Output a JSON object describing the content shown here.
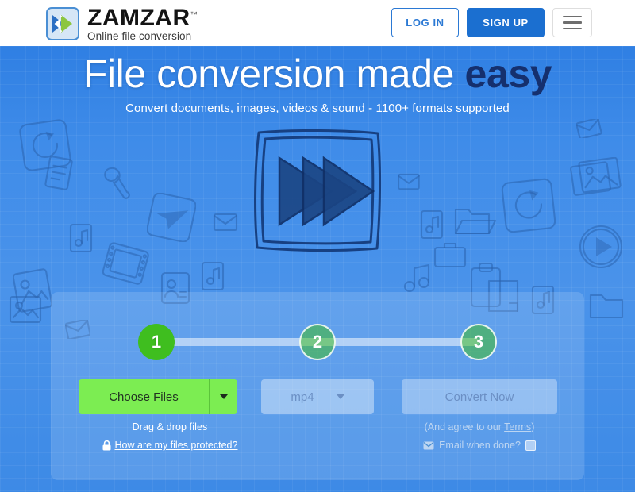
{
  "header": {
    "logo": {
      "icon": "double-chevron-logo-icon",
      "title": "ZAMZAR",
      "tm": "™",
      "tagline": "Online file conversion"
    },
    "login_label": "LOG IN",
    "signup_label": "SIGN UP",
    "menu_icon": "hamburger-menu-icon"
  },
  "hero": {
    "headline_main": "File conversion made ",
    "headline_accent": "easy",
    "subheadline": "Convert documents, images, videos & sound - 1100+ formats supported",
    "illustration_icon": "fast-forward-sketch-icon"
  },
  "converter": {
    "steps": [
      {
        "number": "1",
        "state": "active"
      },
      {
        "number": "2",
        "state": "inactive"
      },
      {
        "number": "3",
        "state": "inactive"
      }
    ],
    "choose_files_label": "Choose Files",
    "choose_files_caret_icon": "chevron-down-icon",
    "format_value": "mp4",
    "format_caret_icon": "chevron-down-icon",
    "convert_label": "Convert Now",
    "drag_drop_text": "Drag & drop files",
    "protected_link": "How are my files protected?",
    "lock_icon": "lock-icon",
    "terms_prefix": "(And agree to our ",
    "terms_link": "Terms",
    "terms_suffix": ")",
    "email_icon": "envelope-icon",
    "email_label": "Email when done?",
    "email_checked": false
  },
  "colors": {
    "brand_blue": "#1b6fd0",
    "hero_blue": "#3f8ce9",
    "accent_green": "#3fbe1f",
    "button_green": "#7ced52",
    "headline_navy": "#15306e",
    "muted_blue": "#6b8fc4"
  }
}
